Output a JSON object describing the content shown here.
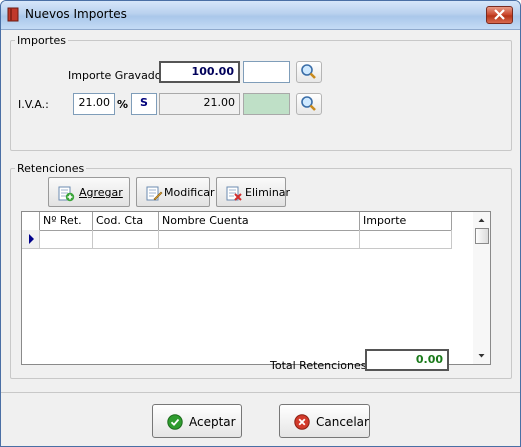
{
  "window": {
    "title": "Nuevos Importes"
  },
  "importes": {
    "legend": "Importes",
    "importe_gravado_label": "Importe Gravado:",
    "importe_gravado_value": "100.00",
    "importe_gravado_extra": "",
    "iva_label": "I.V.A.:",
    "iva_rate": "21.00",
    "percent_sign": "%",
    "iva_flag": "S",
    "iva_amount": "21.00",
    "iva_extra": ""
  },
  "retenciones": {
    "legend": "Retenciones",
    "buttons": [
      {
        "label": "Agregar",
        "icon": "add-document-icon"
      },
      {
        "label": "Modificar",
        "icon": "edit-document-icon"
      },
      {
        "label": "Eliminar",
        "icon": "delete-document-icon"
      }
    ],
    "columns": [
      "Nº Ret.",
      "Cod. Cta",
      "Nombre Cuenta",
      "Importe"
    ],
    "rows": [],
    "total_label": "Total Retenciones:",
    "total_value": "0.00"
  },
  "footer": {
    "accept_label": "Aceptar",
    "cancel_label": "Cancelar"
  },
  "colors": {
    "total_value": "#1a7a1a",
    "importe_gravado_value": "#00005a",
    "iva_extra_fill": "#bfe0c7"
  }
}
